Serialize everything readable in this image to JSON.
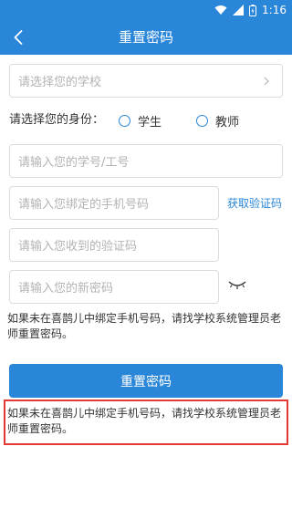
{
  "status_bar": {
    "time": "1:16"
  },
  "header": {
    "title": "重置密码"
  },
  "form": {
    "school_placeholder": "请选择您的学校",
    "role_label": "请选择您的身份：",
    "roles": [
      "学生",
      "教师"
    ],
    "id_placeholder": "请输入您的学号/工号",
    "phone_placeholder": "请输入您绑定的手机号码",
    "get_code_label": "获取验证码",
    "code_placeholder": "请输入您收到的验证码",
    "new_password_placeholder": "请输入您的新密码"
  },
  "hint_text": "如果未在喜鹊儿中绑定手机号码，请找学校系统管理员老师重置密码。",
  "submit_label": "重置密码",
  "colors": {
    "primary": "#2a86d8",
    "highlight": "#e53935"
  },
  "icons": [
    "back-arrow-icon",
    "chevron-right-icon",
    "eye-closed-icon",
    "wifi-icon",
    "signal-icon",
    "battery-icon"
  ]
}
